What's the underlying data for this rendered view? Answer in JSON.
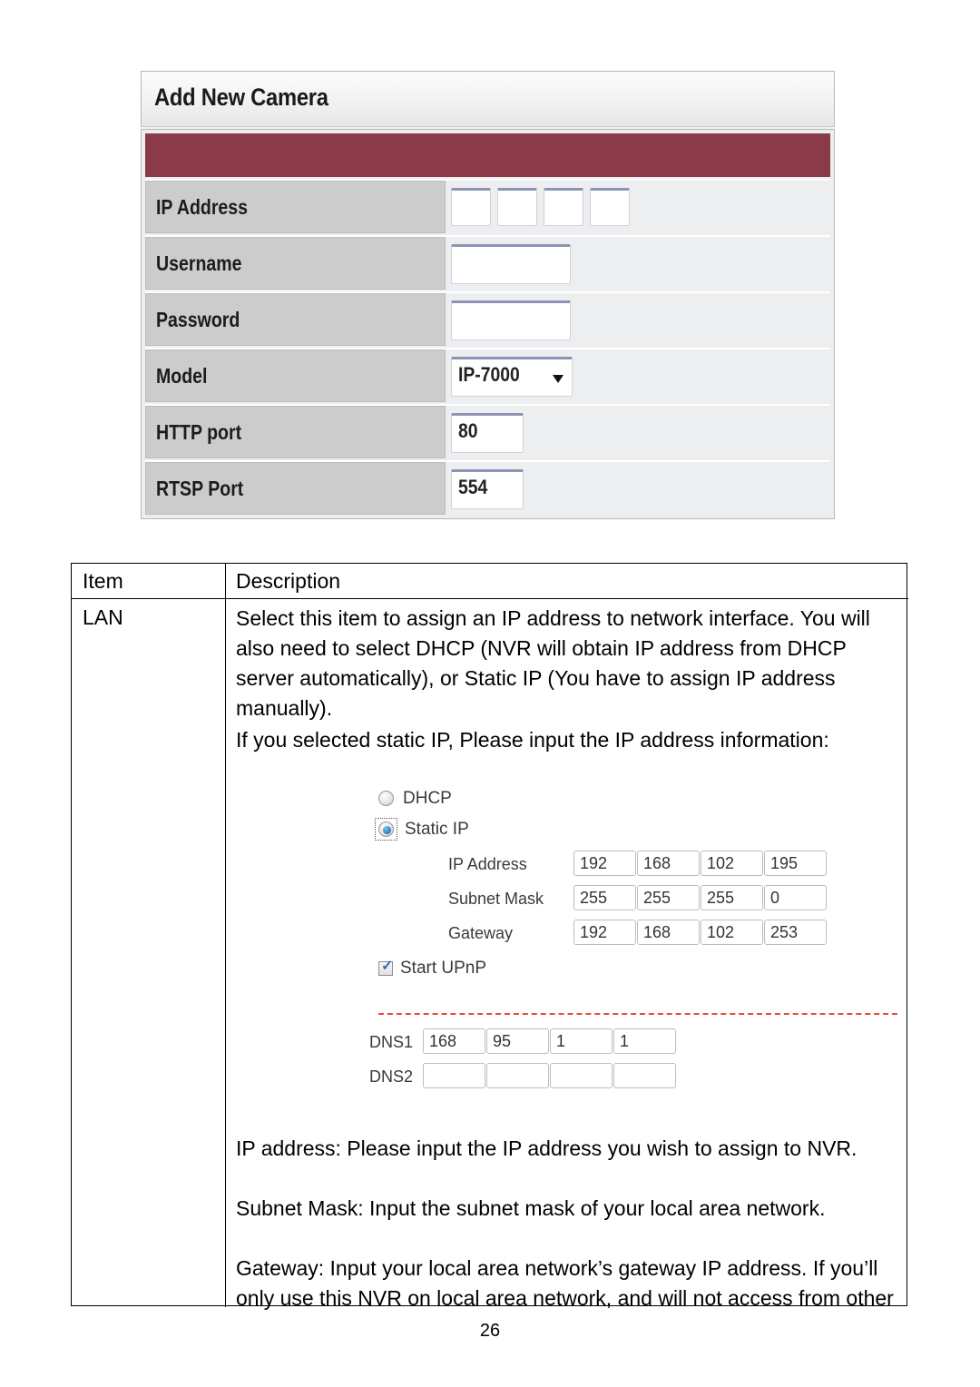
{
  "camera_dialog": {
    "title": "Add New Camera",
    "accent_color": "#8b3a49",
    "rows": [
      {
        "label": "IP Address",
        "type": "ip",
        "octets": [
          "",
          "",
          "",
          ""
        ]
      },
      {
        "label": "Username",
        "type": "text",
        "value": ""
      },
      {
        "label": "Password",
        "type": "text",
        "value": ""
      },
      {
        "label": "Model",
        "type": "select",
        "value": "IP-7000"
      },
      {
        "label": "HTTP port",
        "type": "text",
        "value": "80"
      },
      {
        "label": "RTSP Port",
        "type": "text",
        "value": "554"
      }
    ]
  },
  "table": {
    "headers": {
      "item": "Item",
      "description": "Description"
    },
    "row_item": "LAN",
    "paragraphs": {
      "p1": "Select this item to assign an IP address to network interface. You will also need to select DHCP (NVR will obtain IP address from DHCP server automatically), or Static IP (You have to assign IP address manually).",
      "p2": "If you selected static IP, Please input the IP address information:",
      "p3": "IP address: Please input the IP address you wish to assign to NVR.",
      "p4": "Subnet Mask: Input the subnet mask of your local area network.",
      "p5": "Gateway: Input your local area network’s gateway IP address. If you’ll only use this NVR on local area network, and will not access from other"
    }
  },
  "network_dialog": {
    "mode_options": [
      {
        "label": "DHCP",
        "selected": false
      },
      {
        "label": "Static IP",
        "selected": true
      }
    ],
    "fields": [
      {
        "label": "IP Address",
        "octets": [
          "192",
          "168",
          "102",
          "195"
        ]
      },
      {
        "label": "Subnet Mask",
        "octets": [
          "255",
          "255",
          "255",
          "0"
        ]
      },
      {
        "label": "Gateway",
        "octets": [
          "192",
          "168",
          "102",
          "253"
        ]
      }
    ],
    "upnp": {
      "label": "Start UPnP",
      "checked": true
    },
    "divider_color": "#e8493f",
    "dns": [
      {
        "label": "DNS1",
        "octets": [
          "168",
          "95",
          "1",
          "1"
        ]
      },
      {
        "label": "DNS2",
        "octets": [
          "",
          "",
          "",
          ""
        ]
      }
    ]
  },
  "footer": {
    "page_number": "26"
  }
}
